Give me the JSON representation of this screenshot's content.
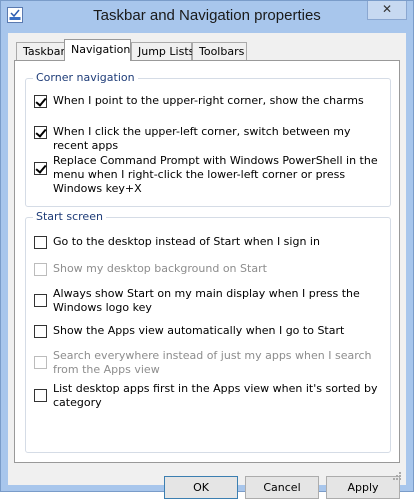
{
  "window": {
    "title": "Taskbar and Navigation properties",
    "close_label": "✕"
  },
  "tabs": [
    {
      "label": "Taskbar"
    },
    {
      "label": "Navigation",
      "active": true
    },
    {
      "label": "Jump Lists"
    },
    {
      "label": "Toolbars"
    }
  ],
  "corner_navigation": {
    "title": "Corner navigation",
    "options": [
      {
        "label": "When I point to the upper-right corner, show the charms",
        "checked": true
      },
      {
        "label": "When I click the upper-left corner, switch between my recent apps",
        "checked": true
      },
      {
        "label": "Replace Command Prompt with Windows PowerShell in the menu when I right-click the lower-left corner or press Windows key+X",
        "checked": true
      }
    ]
  },
  "start_screen": {
    "title": "Start screen",
    "options": [
      {
        "label": "Go to the desktop instead of Start when I sign in",
        "checked": false,
        "enabled": true
      },
      {
        "label": "Show my desktop background on Start",
        "checked": false,
        "enabled": false
      },
      {
        "label": "Always show Start on my main display when I press the Windows logo key",
        "checked": false,
        "enabled": true
      },
      {
        "label": "Show the Apps view automatically when I go to Start",
        "checked": false,
        "enabled": true
      },
      {
        "label": "Search everywhere instead of just my apps when I search from the Apps view",
        "checked": false,
        "enabled": false
      },
      {
        "label": "List desktop apps first in the Apps view when it's sorted by category",
        "checked": false,
        "enabled": true
      }
    ]
  },
  "buttons": {
    "ok": "OK",
    "cancel": "Cancel",
    "apply": "Apply"
  },
  "colors": {
    "title_bar": "#a8c6ec",
    "group_title": "#1e3c78"
  }
}
